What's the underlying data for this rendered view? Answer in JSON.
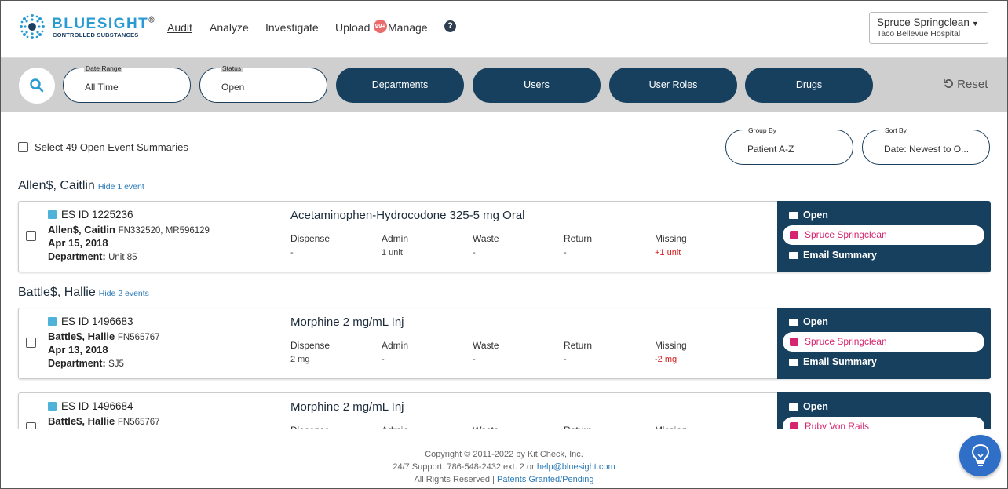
{
  "brand": {
    "name": "BLUESIGHT",
    "registered": "®",
    "subtitle": "CONTROLLED SUBSTANCES",
    "primary_color": "#2a9bd2",
    "dark_color": "#17405f"
  },
  "nav": {
    "items": [
      {
        "label": "Audit",
        "active": true
      },
      {
        "label": "Analyze"
      },
      {
        "label": "Investigate"
      },
      {
        "label": "Upload"
      },
      {
        "label": "Manage"
      }
    ],
    "upload_badge": "99+",
    "help_icon": "question-circle-icon"
  },
  "user": {
    "name": "Spruce Springclean",
    "hospital": "Taco Bellevue Hospital"
  },
  "filters": {
    "date_range": {
      "label": "Date Range",
      "value": "All Time"
    },
    "status": {
      "label": "Status",
      "value": "Open"
    },
    "buttons": [
      "Departments",
      "Users",
      "User Roles",
      "Drugs"
    ],
    "reset_label": "Reset"
  },
  "list": {
    "select_all_label": "Select 49 Open Event Summaries",
    "group_by": {
      "label": "Group By",
      "value": "Patient A-Z"
    },
    "sort_by": {
      "label": "Sort By",
      "value": "Date: Newest to O..."
    },
    "column_headers": [
      "Dispense",
      "Admin",
      "Waste",
      "Return",
      "Missing"
    ],
    "panel": {
      "open_label": "Open",
      "email_label": "Email Summary"
    }
  },
  "groups": [
    {
      "patient": "Allen$, Caitlin",
      "hide_label": "Hide 1 event",
      "events": [
        {
          "es_id": "ES ID 1225236",
          "patient_name": "Allen$, Caitlin",
          "patient_ids": "FN332520, MR596129",
          "date": "Apr 15, 2018",
          "department_label": "Department:",
          "department": "Unit 85",
          "drug": "Acetaminophen-Hydrocodone 325-5 mg Oral",
          "values": [
            "-",
            "1 unit",
            "-",
            "-",
            "+1 unit"
          ],
          "assignee": "Spruce Springclean"
        }
      ]
    },
    {
      "patient": "Battle$, Hallie",
      "hide_label": "Hide 2 events",
      "events": [
        {
          "es_id": "ES ID 1496683",
          "patient_name": "Battle$, Hallie",
          "patient_ids": "FN565767",
          "date": "Apr 13, 2018",
          "department_label": "Department:",
          "department": "SJ5",
          "drug": "Morphine 2 mg/mL Inj",
          "values": [
            "2 mg",
            "-",
            "-",
            "-",
            "-2 mg"
          ],
          "assignee": "Spruce Springclean"
        },
        {
          "es_id": "ES ID 1496684",
          "patient_name": "Battle$, Hallie",
          "patient_ids": "FN565767",
          "drug": "Morphine 2 mg/mL Inj",
          "assignee": "Ruby Von Rails"
        }
      ]
    }
  ],
  "footer": {
    "copyright": "Copyright © 2011-2022 by Kit Check, Inc.",
    "support": "24/7 Support: 786-548-2432 ext. 2 or",
    "support_email": "help@bluesight.com",
    "rights": "All Rights Reserved |",
    "patents": "Patents Granted/Pending"
  }
}
